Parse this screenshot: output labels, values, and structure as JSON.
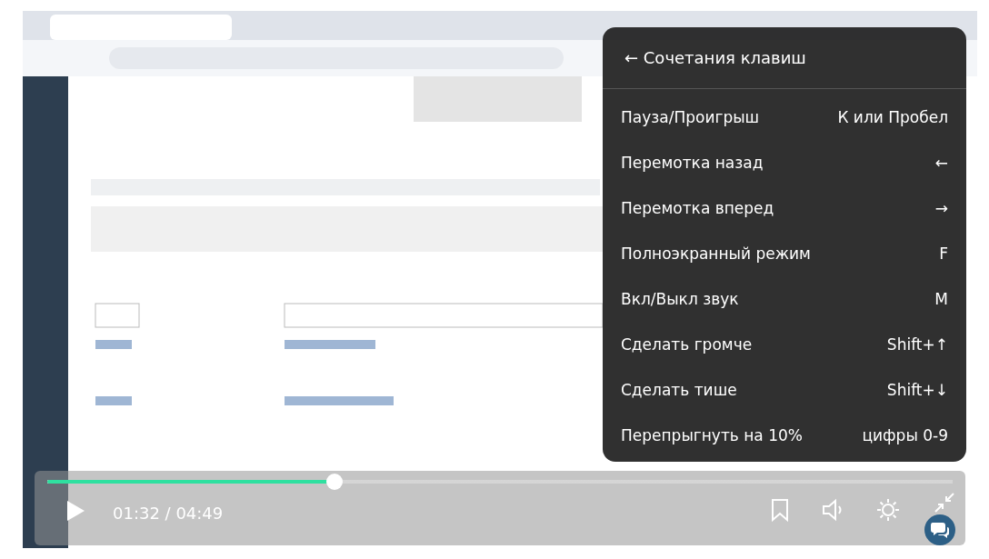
{
  "player": {
    "kind": "picture",
    "progress": {
      "level": 0.317
    },
    "time": "01:32 / 04:49",
    "shortcuts": {
      "title": "← Сочетания клавиш",
      "items": [
        {
          "action": "Пауза/Проигрыш",
          "keys": "К или Пробел"
        },
        {
          "action": "Перемотка назад",
          "keys": "←"
        },
        {
          "action": "Перемотка вперед",
          "keys": "→"
        },
        {
          "action": "Полноэкранный режим",
          "keys": "F"
        },
        {
          "action": "Вкл/Выкл звук",
          "keys": "M"
        },
        {
          "action": "Сделать громче",
          "keys": "Shift+↑"
        },
        {
          "action": "Сделать тише",
          "keys": "Shift+↓"
        },
        {
          "action": "Перепрыгнуть на 10%",
          "keys": "цифры 0-9"
        }
      ]
    }
  }
}
